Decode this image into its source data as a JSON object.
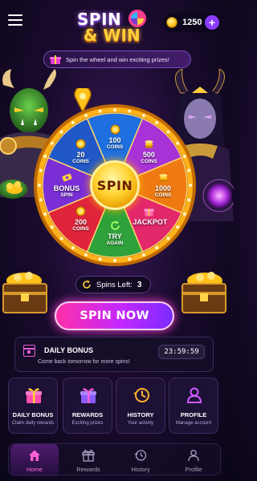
{
  "header": {
    "logo_line1": "SPIN",
    "logo_line2": "& WIN",
    "coins": "1250",
    "plus_label": "+"
  },
  "banner": {
    "text": "Spin the wheel and win exciting prizes!"
  },
  "wheel": {
    "hub_label": "SPIN",
    "segments": [
      {
        "value": "100",
        "unit": "COINS",
        "color": "#1e6fe0",
        "icon": "coin-icon"
      },
      {
        "value": "500",
        "unit": "COINS",
        "color": "#a832d6",
        "icon": "coin-stack-icon"
      },
      {
        "value": "1000",
        "unit": "COINS",
        "color": "#f07a12",
        "icon": "coin-stack-icon"
      },
      {
        "value": "JACKPOT",
        "unit": "",
        "color": "#e3276b",
        "icon": "gift-icon"
      },
      {
        "value": "TRY",
        "unit": "AGAIN",
        "color": "#2fa13a",
        "icon": "refresh-icon"
      },
      {
        "value": "200",
        "unit": "COINS",
        "color": "#e0243a",
        "icon": "coin-icon"
      },
      {
        "value": "BONUS",
        "unit": "SPIN",
        "color": "#7a2fd6",
        "icon": "ticket-icon"
      },
      {
        "value": "20",
        "unit": "COINS",
        "color": "#2058c9",
        "icon": "coin-icon"
      }
    ]
  },
  "spins": {
    "label": "Spins Left:",
    "count": "3"
  },
  "spin_now": {
    "label": "SPIN NOW"
  },
  "daily_bonus": {
    "title": "DAILY BONUS",
    "subtitle": "Come back tomorrow for more spins!",
    "timer": "23:59:59"
  },
  "tiles": [
    {
      "title": "DAILY BONUS",
      "sub": "Claim daily rewards",
      "icon": "gift-icon",
      "color": "#ff4fb0"
    },
    {
      "title": "REWARDS",
      "sub": "Exciting prizes",
      "icon": "gift-icon",
      "color": "#8a5bff"
    },
    {
      "title": "HISTORY",
      "sub": "Your activity",
      "icon": "history-icon",
      "color": "#ffb02e"
    },
    {
      "title": "PROFILE",
      "sub": "Manage account",
      "icon": "user-icon",
      "color": "#d05cff"
    }
  ],
  "nav": [
    {
      "label": "Home",
      "icon": "home-icon",
      "active": true
    },
    {
      "label": "Rewards",
      "icon": "gift-icon",
      "active": false
    },
    {
      "label": "History",
      "icon": "history-icon",
      "active": false
    },
    {
      "label": "Profile",
      "icon": "user-icon",
      "active": false
    }
  ]
}
